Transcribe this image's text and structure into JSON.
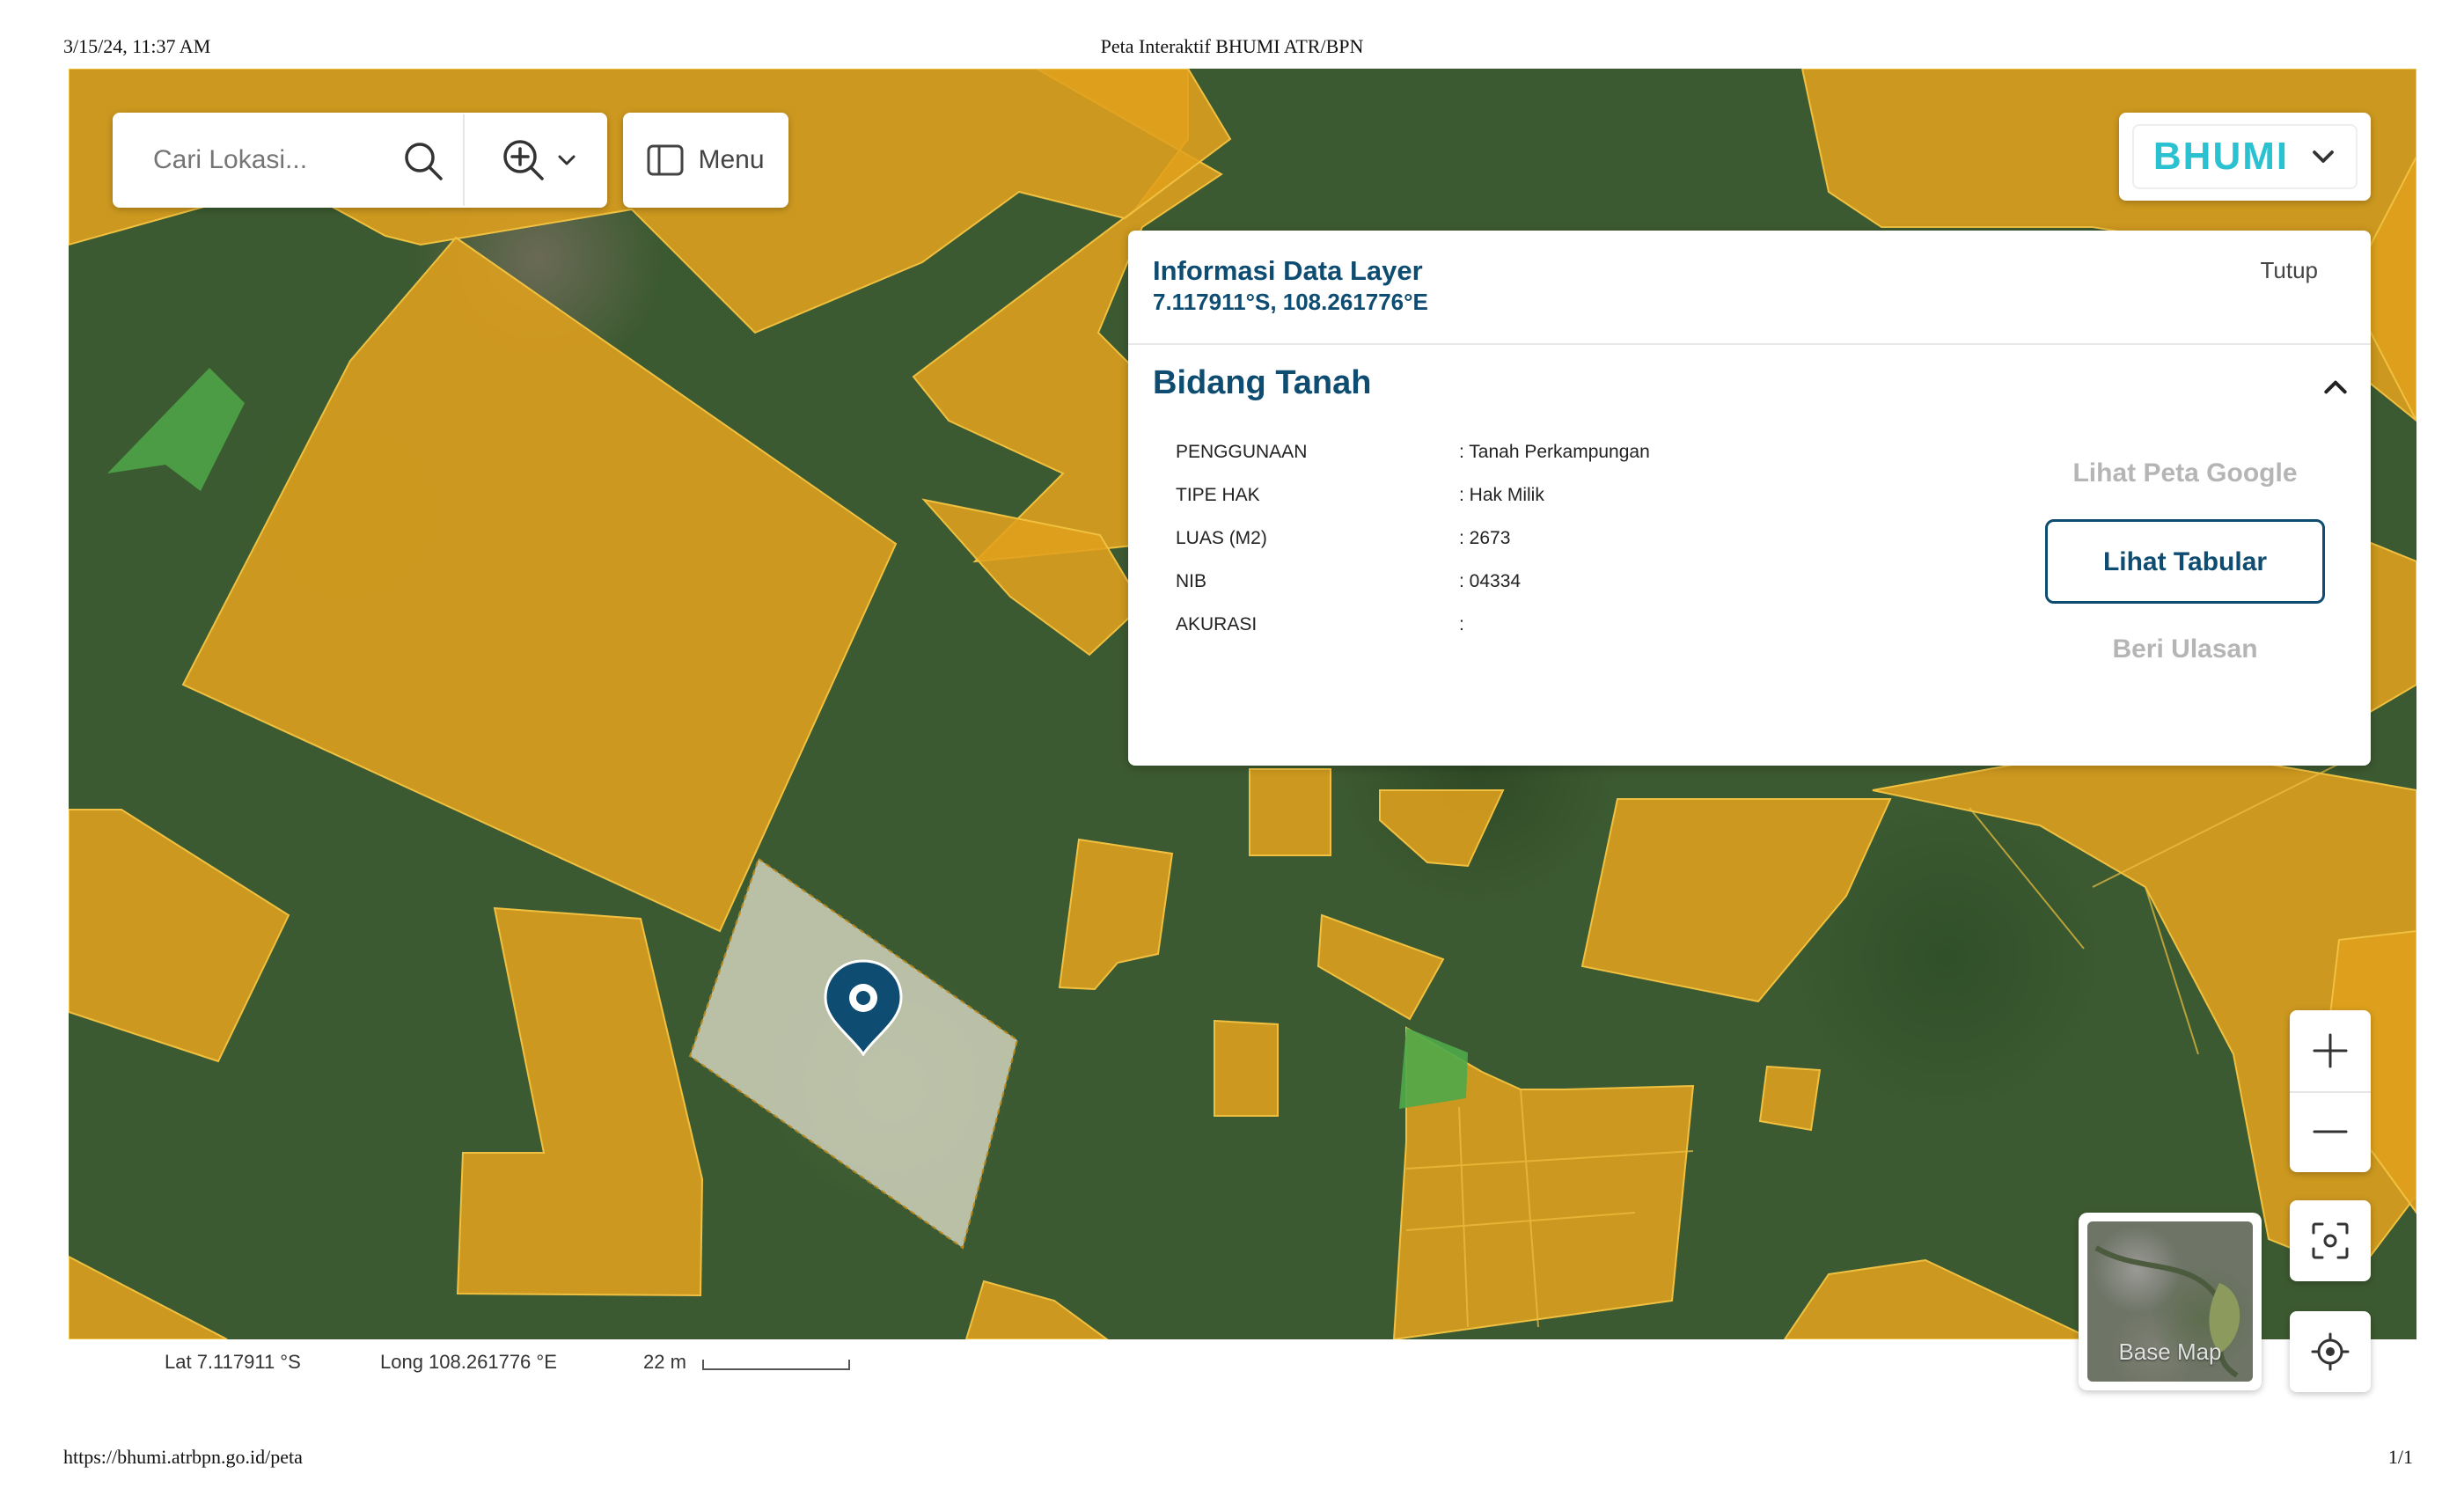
{
  "print": {
    "date": "3/15/24, 11:37 AM",
    "title": "Peta Interaktif BHUMI ATR/BPN",
    "url": "https://bhumi.atrbpn.go.id/peta",
    "page": "1/1"
  },
  "search": {
    "placeholder": "Cari Lokasi..."
  },
  "toolbar": {
    "menu_label": "Menu"
  },
  "brand": {
    "name": "BHUMI",
    "color": "#2bc1d0"
  },
  "info_panel": {
    "title": "Informasi Data Layer",
    "coordinates": "7.117911°S, 108.261776°E",
    "close_label": "Tutup",
    "section_title": "Bidang Tanah",
    "attributes": [
      {
        "key": "PENGGUNAAN",
        "value": ": Tanah Perkampungan"
      },
      {
        "key": "TIPE HAK",
        "value": ": Hak Milik"
      },
      {
        "key": "LUAS (M2)",
        "value": ": 2673"
      },
      {
        "key": "NIB",
        "value": ": 04334"
      },
      {
        "key": "AKURASI",
        "value": ":"
      }
    ],
    "actions": {
      "google_map": "Lihat Peta Google",
      "tabular": "Lihat Tabular",
      "review": "Beri Ulasan"
    },
    "accent_color": "#0e4c72"
  },
  "map_controls": {
    "basemap_label": "Base Map"
  },
  "status": {
    "lat": "Lat 7.117911 °S",
    "long": "Long 108.261776 °E",
    "scale": "22 m"
  },
  "colors": {
    "parcel_fill": "#e0a01c",
    "parcel_selected": "#d9d9c4",
    "green_parcel": "#4fa84a",
    "marker": "#0e4c72"
  }
}
